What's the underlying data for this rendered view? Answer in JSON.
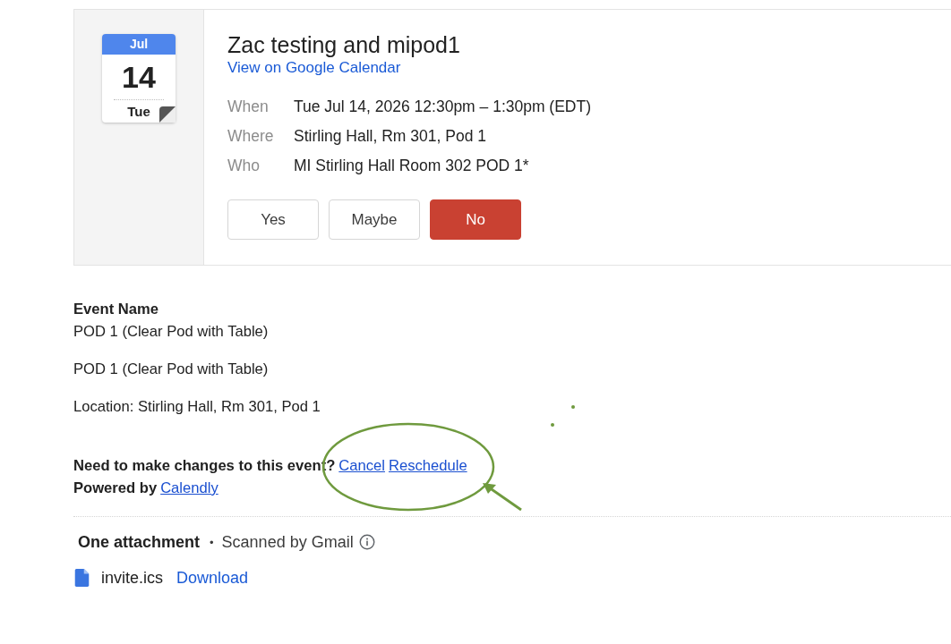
{
  "invite": {
    "calendar_icon": {
      "month": "Jul",
      "day": "14",
      "weekday": "Tue"
    },
    "title": "Zac testing and mipod1",
    "calendar_link": "View on Google Calendar",
    "details": [
      {
        "label": "When",
        "value": "Tue Jul 14, 2026 12:30pm – 1:30pm (EDT)"
      },
      {
        "label": "Where",
        "value": "Stirling Hall, Rm 301, Pod 1"
      },
      {
        "label": "Who",
        "value": "MI Stirling Hall Room 302 POD 1*"
      }
    ],
    "rsvp": [
      {
        "label": "Yes",
        "selected": false
      },
      {
        "label": "Maybe",
        "selected": false
      },
      {
        "label": "No",
        "selected": true
      }
    ]
  },
  "body": {
    "heading": "Event Name",
    "paragraphs": [
      "POD 1 (Clear Pod with Table)",
      "POD 1 (Clear Pod with Table)",
      "Location: Stirling Hall, Rm 301, Pod 1"
    ],
    "changes": {
      "prompt": "Need to make changes to this event?",
      "links": [
        "Cancel",
        "Reschedule"
      ]
    },
    "powered_by": {
      "label": "Powered by",
      "link": "Calendly"
    }
  },
  "attachments": {
    "title": "One attachment",
    "separator": "•",
    "scan_note": "Scanned by Gmail",
    "files": [
      {
        "name": "invite.ics",
        "action": "Download"
      }
    ]
  }
}
